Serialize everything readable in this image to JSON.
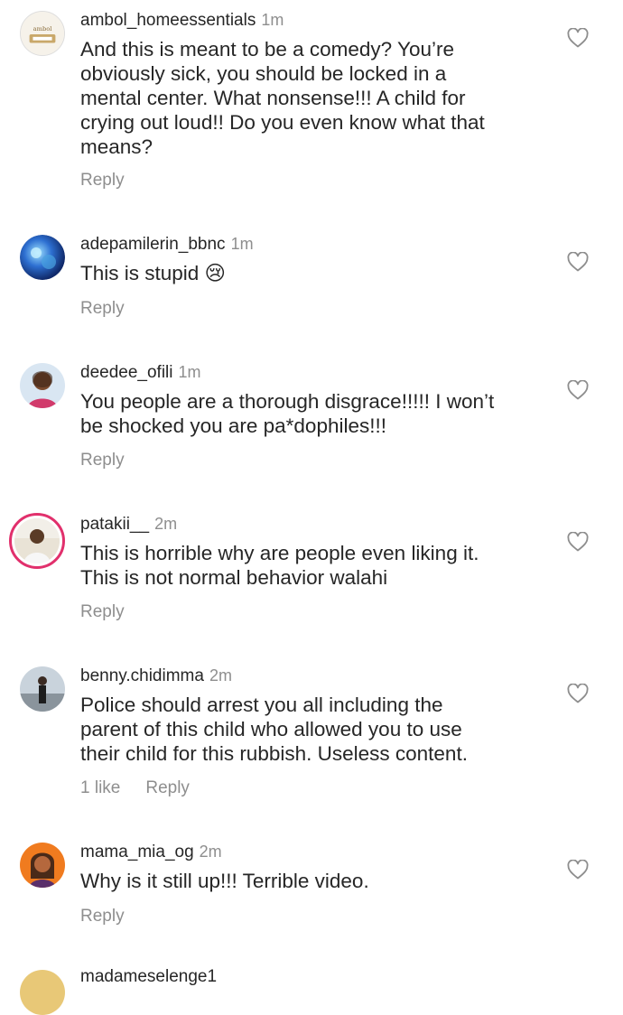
{
  "comments": [
    {
      "username": "ambol_homeessentials",
      "time": "1m",
      "text": "And this is meant to be a comedy? You’re\nobviously sick, you should be locked in a\nmental center. What nonsense!!! A child for\ncrying out loud!! Do you even know what that\nmeans?",
      "likes": "",
      "reply": "Reply"
    },
    {
      "username": "adepamilerin_bbnc",
      "time": "1m",
      "text": "This is stupid 😢",
      "likes": "",
      "reply": "Reply"
    },
    {
      "username": "deedee_ofili",
      "time": "1m",
      "text": "You people are a thorough disgrace!!!!! I won’t\nbe shocked you are pa*dophiles!!!",
      "likes": "",
      "reply": "Reply"
    },
    {
      "username": "patakii__",
      "time": "2m",
      "text": "This is horrible why are people even liking it.\nThis is not normal behavior walahi",
      "likes": "",
      "reply": "Reply"
    },
    {
      "username": "benny.chidimma",
      "time": "2m",
      "text": "Police should arrest you all including the\nparent of this child who allowed you to use\ntheir child for this rubbish. Useless content.",
      "likes": "1 like",
      "reply": "Reply"
    },
    {
      "username": "mama_mia_og",
      "time": "2m",
      "text": "Why is it still up!!! Terrible video.",
      "likes": "",
      "reply": "Reply"
    }
  ],
  "partial_comment": {
    "username": "madameselenge1"
  },
  "icons": {
    "like": "heart-outline-icon"
  },
  "colors": {
    "text": "#262626",
    "secondary": "#8e8e8e",
    "story_ring": "#e1306c"
  }
}
